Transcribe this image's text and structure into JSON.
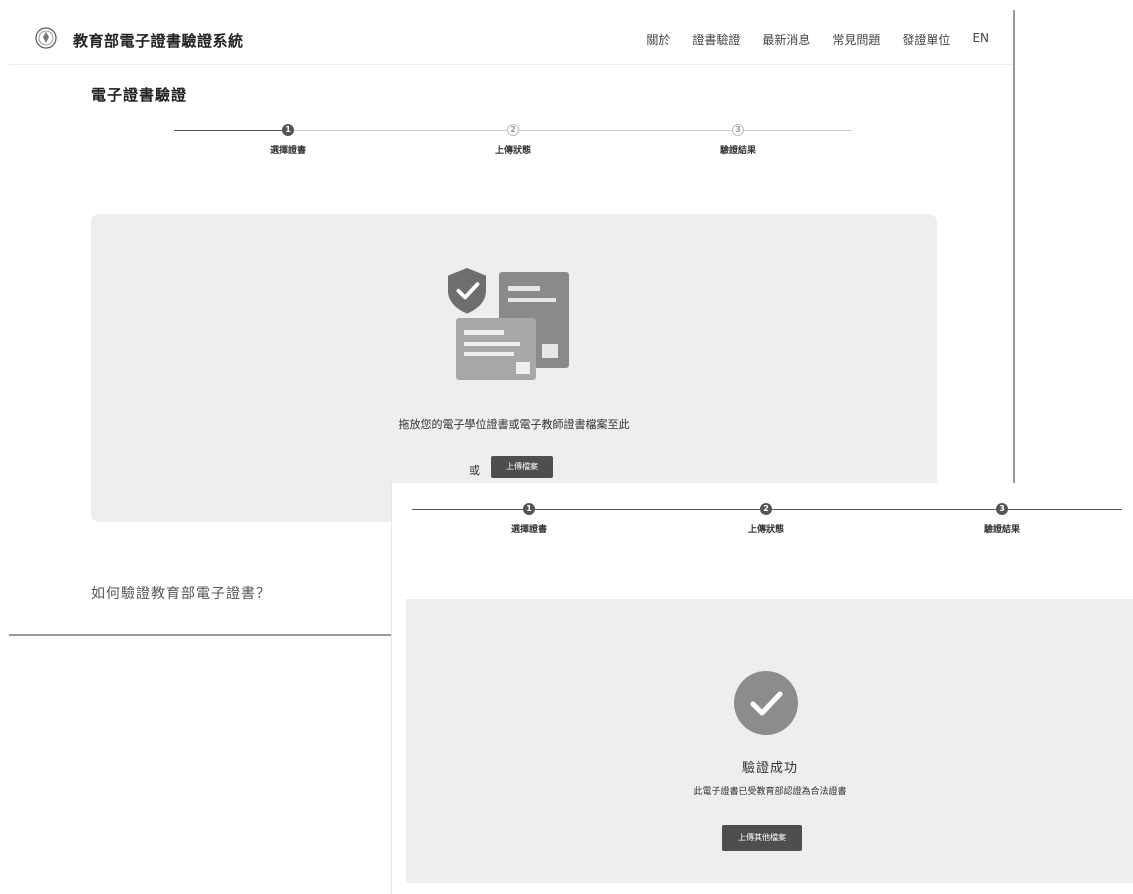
{
  "header": {
    "system_title": "教育部電子證書驗證系統",
    "nav": [
      "關於",
      "證書驗證",
      "最新消息",
      "常見問題",
      "發證單位",
      "EN"
    ]
  },
  "page": {
    "title": "電子證書驗證"
  },
  "steps": [
    {
      "num": "1",
      "label": "選擇證書"
    },
    {
      "num": "2",
      "label": "上傳狀態"
    },
    {
      "num": "3",
      "label": "驗證結果"
    }
  ],
  "upload": {
    "hint": "拖放您的電子學位證書或電子教師證書檔案至此",
    "or": "或",
    "button": "上傳檔案"
  },
  "howto": "如何驗證教育部電子證書？",
  "result": {
    "title": "驗證成功",
    "description": "此電子證書已受教育部認證為合法證書",
    "button": "上傳其他檔案"
  },
  "icons": {
    "logo": "ministry-seal-icon",
    "certificate": "certificate-shield-icon",
    "success": "check-circle-icon"
  },
  "colors": {
    "accent": "#4e4e4e",
    "panel": "#eeeeee",
    "success": "#8c8c8c"
  }
}
